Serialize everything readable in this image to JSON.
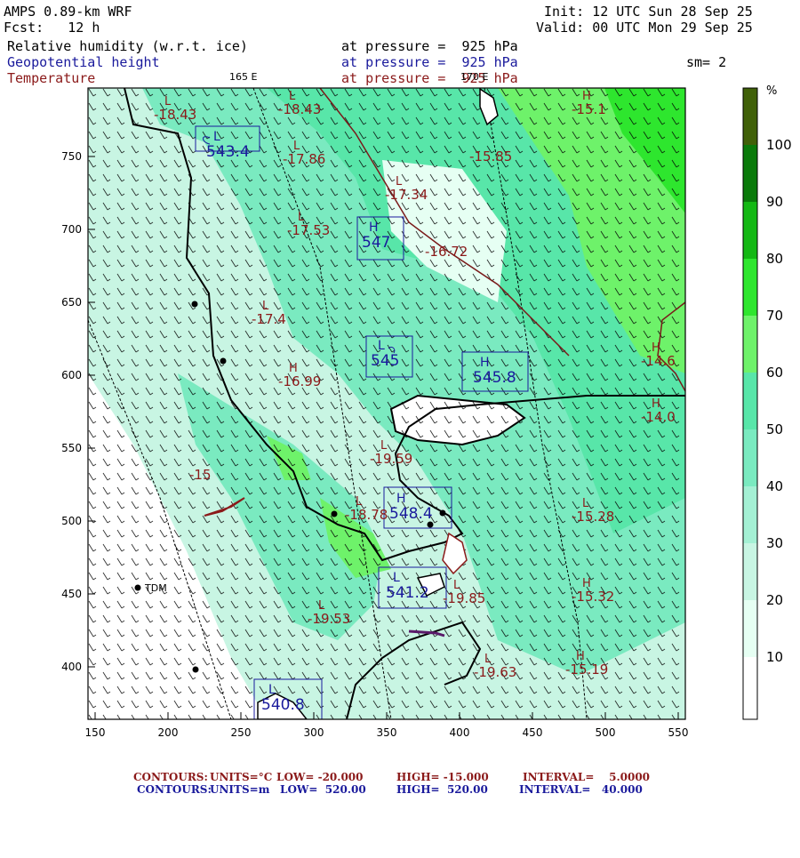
{
  "header": {
    "model": "AMPS 0.89-km WRF",
    "forecast": "Fcst:   12 h",
    "init": "Init: 12 UTC Sun 28 Sep 25",
    "valid": "Valid: 00 UTC Mon 29 Sep 25",
    "field1": "Relative humidity (w.r.t. ice)",
    "field1_level": "at pressure =  925 hPa",
    "field2": "Geopotential height",
    "field2_level": "at pressure =  925 hPa",
    "field3": "Temperature",
    "field3_level": "at pressure =  925 hPa",
    "smoothing": "sm= 2"
  },
  "map": {
    "longitude_labels": [
      "165 E",
      "170 E"
    ],
    "x_ticks": [
      "150",
      "200",
      "250",
      "300",
      "350",
      "400",
      "450",
      "500",
      "550"
    ],
    "y_ticks": [
      "750",
      "700",
      "650",
      "600",
      "550",
      "500",
      "450",
      "400"
    ],
    "station_label": "TDM",
    "height_labels": [
      {
        "kind": "L",
        "value": "543.4"
      },
      {
        "kind": "H",
        "value": "547"
      },
      {
        "kind": "L",
        "value": "545"
      },
      {
        "kind": "H",
        "value": "545.8"
      },
      {
        "kind": "H",
        "value": "548.4"
      },
      {
        "kind": "L",
        "value": "541.2"
      },
      {
        "kind": "L",
        "value": "540.8"
      }
    ],
    "temperature_labels": [
      {
        "kind": "L",
        "value": "-18.43"
      },
      {
        "kind": "L",
        "value": "-18.43"
      },
      {
        "kind": "H",
        "value": "-15.1"
      },
      {
        "kind": "L",
        "value": "-17.86"
      },
      {
        "kind": "",
        "value": "-15.85"
      },
      {
        "kind": "L",
        "value": "-17.34"
      },
      {
        "kind": "L",
        "value": "-17.53"
      },
      {
        "kind": "",
        "value": "-16.72"
      },
      {
        "kind": "L",
        "value": "-17.4"
      },
      {
        "kind": "H",
        "value": "-16.99"
      },
      {
        "kind": "H",
        "value": "-14.6"
      },
      {
        "kind": "H",
        "value": "-14.0"
      },
      {
        "kind": "L",
        "value": "-19.59"
      },
      {
        "kind": "",
        "value": "-15"
      },
      {
        "kind": "L",
        "value": "-18.78"
      },
      {
        "kind": "L",
        "value": "-15.28"
      },
      {
        "kind": "L",
        "value": "-19.85"
      },
      {
        "kind": "H",
        "value": "-15.32"
      },
      {
        "kind": "L",
        "value": "-19.53"
      },
      {
        "kind": "L",
        "value": "-19.63"
      },
      {
        "kind": "H",
        "value": "-15.19"
      }
    ]
  },
  "colorbar": {
    "unit": "%",
    "labels": [
      "100",
      "90",
      "80",
      "70",
      "60",
      "50",
      "40",
      "30",
      "20",
      "10"
    ],
    "colors": [
      "#ffffff",
      "#e6fff3",
      "#c8f5e3",
      "#a4f0d4",
      "#7aeac0",
      "#58e6a9",
      "#6ef26a",
      "#2ee62e",
      "#14b814",
      "#0a7a0a",
      "#406008"
    ]
  },
  "footer": {
    "line1": {
      "contours": "CONTOURS:",
      "units": "UNITS=°C",
      "low": "LOW= -20.000",
      "high": "HIGH= -15.000",
      "interval": "INTERVAL=    5.0000"
    },
    "line2": {
      "contours": "CONTOURS:",
      "units": "UNITS=m",
      "low": "LOW=  520.00",
      "high": "HIGH=  520.00",
      "interval": "INTERVAL=   40.000"
    }
  }
}
